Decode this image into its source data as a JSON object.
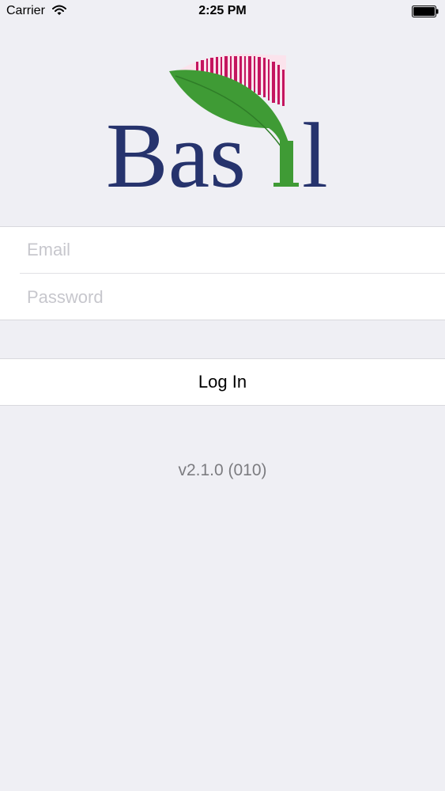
{
  "status_bar": {
    "carrier": "Carrier",
    "time": "2:25 PM"
  },
  "logo": {
    "text": "Basil",
    "colors": {
      "navy": "#26336d",
      "green": "#3f9b35",
      "magenta": "#c4155f"
    }
  },
  "login_form": {
    "email_placeholder": "Email",
    "password_placeholder": "Password",
    "login_label": "Log In"
  },
  "version": "v2.1.0 (010)",
  "colors": {
    "background": "#efeff4",
    "placeholder": "#c7c7cd",
    "version_text": "#7c7c80"
  }
}
